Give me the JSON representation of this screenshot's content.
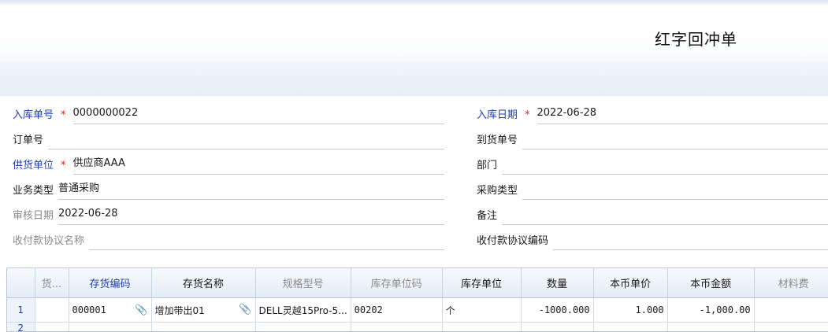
{
  "doc_title": "红字回冲单",
  "fields": {
    "receipt_no": {
      "label": "入库单号",
      "value": "0000000022"
    },
    "receipt_date": {
      "label": "入库日期",
      "value": "2022-06-28"
    },
    "order_no": {
      "label": "订单号",
      "value": ""
    },
    "arrival_no": {
      "label": "到货单号",
      "value": ""
    },
    "supplier": {
      "label": "供货单位",
      "value": "供应商AAA"
    },
    "dept": {
      "label": "部门",
      "value": ""
    },
    "biz_type": {
      "label": "业务类型",
      "value": "普通采购"
    },
    "purchase_type": {
      "label": "采购类型",
      "value": ""
    },
    "audit_date": {
      "label": "审核日期",
      "value": "2022-06-28"
    },
    "remark": {
      "label": "备注",
      "value": ""
    },
    "payment_name": {
      "label": "收付款协议名称",
      "value": ""
    },
    "payment_code": {
      "label": "收付款协议编码",
      "value": ""
    }
  },
  "required_mark": "*",
  "grid": {
    "headers": [
      "货...",
      "存货编码",
      "存货名称",
      "规格型号",
      "库存单位码",
      "库存单位",
      "数量",
      "本币单价",
      "本币金额",
      "材料费"
    ],
    "rows": [
      {
        "num": "1",
        "c0": "",
        "code": "000001",
        "name": "增加带出01",
        "spec": "DELL灵越15Pro-5...",
        "unit_code": "00202",
        "unit": "个",
        "qty": "-1000.000",
        "price": "1.000",
        "amount": "-1,000.00",
        "material": ""
      },
      {
        "num": "2",
        "c0": "",
        "code": "",
        "name": "",
        "spec": "",
        "unit_code": "",
        "unit": "",
        "qty": "",
        "price": "",
        "amount": "",
        "material": ""
      }
    ]
  },
  "icons": {
    "attach": "paperclip-icon"
  }
}
